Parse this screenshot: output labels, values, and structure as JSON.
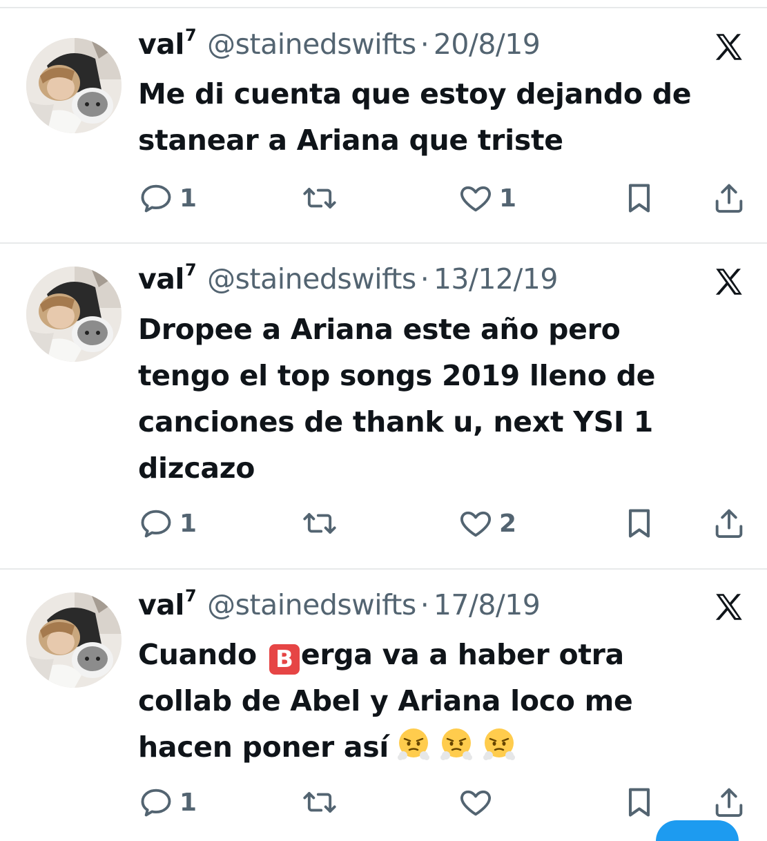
{
  "tweets": [
    {
      "name": "val",
      "name_sup": "7",
      "handle": "@stainedswifts",
      "separator": "·",
      "date": "20/8/19",
      "text_lines": [
        "Me di cuenta que estoy dejando de",
        "stanear a Ariana que triste"
      ],
      "replies": "1",
      "retweets": "",
      "likes": "1",
      "icons": [
        "reply-icon",
        "retweet-icon",
        "like-icon",
        "bookmark-icon",
        "share-icon",
        "x-logo-icon"
      ]
    },
    {
      "name": "val",
      "name_sup": "7",
      "handle": "@stainedswifts",
      "separator": "·",
      "date": "13/12/19",
      "text_lines": [
        "Dropee a Ariana este año pero",
        "tengo el top songs 2019 lleno de",
        "canciones de thank u, next YSI 1",
        "dizcazo"
      ],
      "replies": "1",
      "retweets": "",
      "likes": "2",
      "icons": [
        "reply-icon",
        "retweet-icon",
        "like-icon",
        "bookmark-icon",
        "share-icon",
        "x-logo-icon"
      ]
    },
    {
      "name": "val",
      "name_sup": "7",
      "handle": "@stainedswifts",
      "separator": "·",
      "date": "17/8/19",
      "text_line1_a": "Cuando ",
      "badge_letter": "B",
      "text_line1_b": "erga va a haber otra",
      "text_line2": "collab de Abel y Ariana loco me",
      "text_line3": "hacen poner así",
      "emoji": "face-with-steam-from-nose x3",
      "replies": "1",
      "retweets": "",
      "likes": "",
      "icons": [
        "reply-icon",
        "retweet-icon",
        "like-icon",
        "bookmark-icon",
        "share-icon",
        "x-logo-icon"
      ]
    }
  ],
  "colors": {
    "text": "#0f1419",
    "muted": "#536471",
    "divider": "#e7e9ea",
    "badge": "#e64545"
  }
}
